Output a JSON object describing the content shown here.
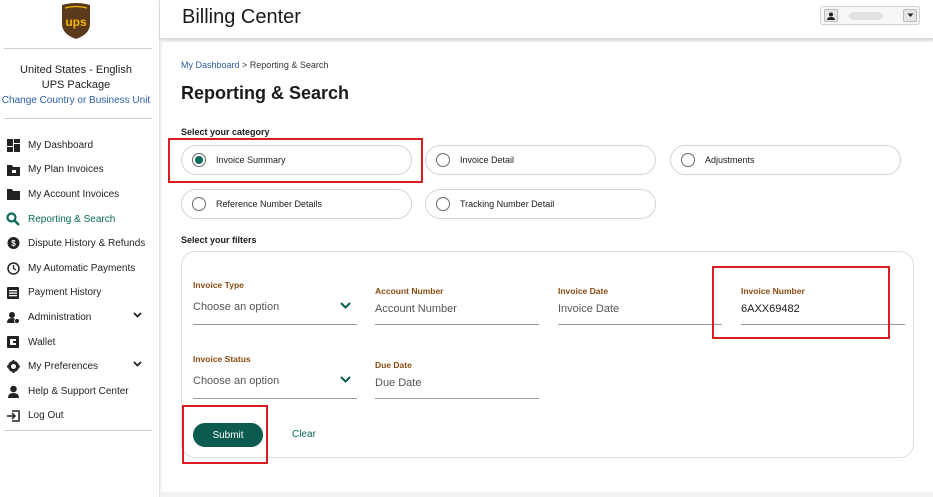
{
  "sidebar": {
    "logo_text": "ups",
    "region_line1": "United States - English",
    "region_line2": "UPS Package",
    "region_link": "Change Country or Business Unit",
    "items": [
      {
        "label": "My Dashboard",
        "icon": "dashboard-icon"
      },
      {
        "label": "My Plan Invoices",
        "icon": "folder-icon"
      },
      {
        "label": "My Account Invoices",
        "icon": "document-icon"
      },
      {
        "label": "Reporting & Search",
        "icon": "search-icon",
        "active": true
      },
      {
        "label": "Dispute History & Refunds",
        "icon": "dollar-bubble-icon"
      },
      {
        "label": "My Automatic Payments",
        "icon": "clock-icon"
      },
      {
        "label": "Payment History",
        "icon": "list-icon"
      },
      {
        "label": "Administration",
        "icon": "admin-icon",
        "expandable": true
      },
      {
        "label": "Wallet",
        "icon": "wallet-icon"
      },
      {
        "label": "My Preferences",
        "icon": "gear-icon",
        "expandable": true
      },
      {
        "label": "Help & Support Center",
        "icon": "support-agent-icon"
      },
      {
        "label": "Log Out",
        "icon": "logout-icon"
      }
    ]
  },
  "header": {
    "title": "Billing Center"
  },
  "breadcrumb": {
    "home": "My Dashboard",
    "separator": " > ",
    "current": "Reporting & Search"
  },
  "page_title": "Reporting & Search",
  "category": {
    "label": "Select your category",
    "options": [
      {
        "label": "Invoice Summary",
        "selected": true
      },
      {
        "label": "Invoice Detail",
        "selected": false
      },
      {
        "label": "Adjustments",
        "selected": false
      },
      {
        "label": "Reference Number Details",
        "selected": false
      },
      {
        "label": "Tracking Number Detail",
        "selected": false
      }
    ]
  },
  "filters": {
    "label": "Select your filters",
    "invoice_type": {
      "label": "Invoice Type",
      "value": "Choose an option"
    },
    "account_number": {
      "label": "Account Number",
      "placeholder": "Account Number"
    },
    "invoice_date": {
      "label": "Invoice Date",
      "placeholder": "Invoice Date"
    },
    "invoice_number": {
      "label": "Invoice Number",
      "value": "6AXX69482"
    },
    "invoice_status": {
      "label": "Invoice Status",
      "value": "Choose an option"
    },
    "due_date": {
      "label": "Due Date",
      "placeholder": "Due Date"
    }
  },
  "actions": {
    "submit": "Submit",
    "clear": "Clear"
  },
  "colors": {
    "brand_green": "#0b5b4e",
    "label_brown": "#8a4b12",
    "ups_brown": "#5a3a1a",
    "ups_gold": "#f5b400",
    "annotation_red": "#d81e1e"
  }
}
